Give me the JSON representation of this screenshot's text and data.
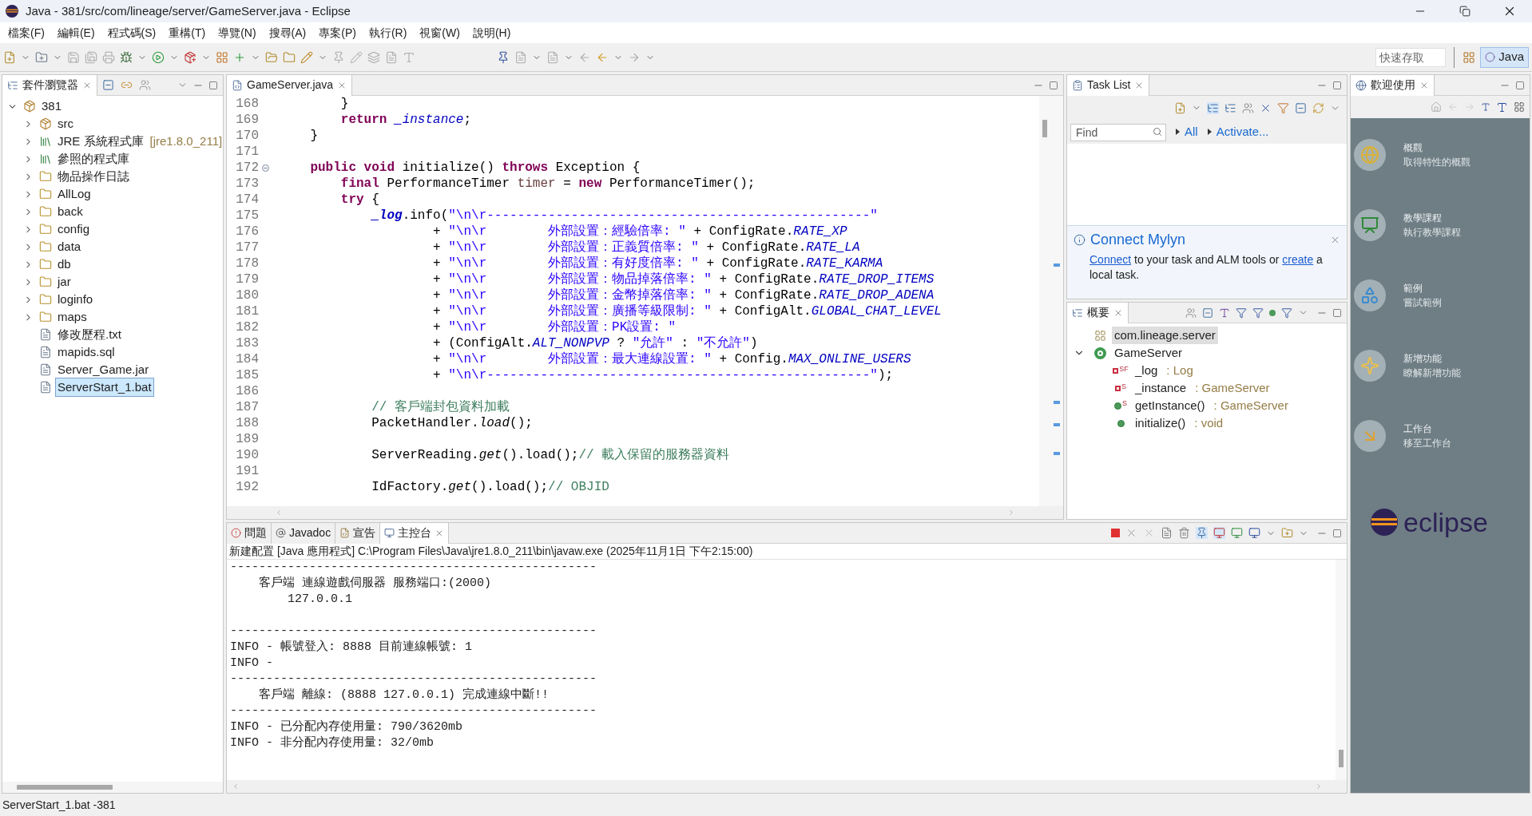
{
  "window": {
    "title": "Java - 381/src/com/lineage/server/GameServer.java - Eclipse"
  },
  "menu": [
    "檔案(F)",
    "編輯(E)",
    "程式碼(S)",
    "重構(T)",
    "導覽(N)",
    "搜尋(A)",
    "專案(P)",
    "執行(R)",
    "視窗(W)",
    "說明(H)"
  ],
  "quick_access": {
    "placeholder": "快速存取"
  },
  "perspective": {
    "label": "Java",
    "selected": true
  },
  "package_explorer": {
    "tab": "套件瀏覽器",
    "tree": [
      {
        "label": "381",
        "kind": "project",
        "expanded": true,
        "selected": false,
        "children": [
          {
            "label": "src",
            "kind": "source_folder",
            "expanded": false,
            "selected": false
          },
          {
            "label": "JRE 系統程式庫",
            "decoration": "[jre1.8.0_211]",
            "kind": "library",
            "expanded": false,
            "selected": false
          },
          {
            "label": "參照的程式庫",
            "kind": "library",
            "expanded": false,
            "selected": false
          },
          {
            "label": "物品操作日誌",
            "kind": "folder",
            "expanded": false,
            "selected": false
          },
          {
            "label": "AllLog",
            "kind": "folder",
            "expanded": false,
            "selected": false
          },
          {
            "label": "back",
            "kind": "folder",
            "expanded": false,
            "selected": false
          },
          {
            "label": "config",
            "kind": "folder",
            "expanded": false,
            "selected": false
          },
          {
            "label": "data",
            "kind": "folder",
            "expanded": false,
            "selected": false
          },
          {
            "label": "db",
            "kind": "folder",
            "expanded": false,
            "selected": false
          },
          {
            "label": "jar",
            "kind": "folder",
            "expanded": false,
            "selected": false
          },
          {
            "label": "loginfo",
            "kind": "folder",
            "expanded": false,
            "selected": false
          },
          {
            "label": "maps",
            "kind": "folder",
            "expanded": false,
            "selected": false
          },
          {
            "label": "修改歷程.txt",
            "kind": "file",
            "selected": false
          },
          {
            "label": "mapids.sql",
            "kind": "file",
            "selected": false
          },
          {
            "label": "Server_Game.jar",
            "kind": "file",
            "selected": false
          },
          {
            "label": "ServerStart_1.bat",
            "kind": "file",
            "selected": true
          }
        ]
      }
    ]
  },
  "editor": {
    "tab": "GameServer.java",
    "lines": [
      {
        "number": "168",
        "segments": [
          {
            "kind": "plain",
            "text": "        }"
          }
        ]
      },
      {
        "number": "169",
        "segments": [
          {
            "kind": "keyword",
            "text": "        return "
          },
          {
            "kind": "static_field",
            "text": "_instance"
          },
          {
            "kind": "plain",
            "text": ";"
          }
        ]
      },
      {
        "number": "170",
        "segments": [
          {
            "kind": "plain",
            "text": "    }"
          }
        ]
      },
      {
        "number": "171"
      },
      {
        "number": "172",
        "fold_toggle": true,
        "segments": [
          {
            "kind": "keyword",
            "text": "    public void"
          },
          {
            "kind": "plain",
            "text": " initialize() "
          },
          {
            "kind": "keyword",
            "text": "throws"
          },
          {
            "kind": "plain",
            "text": " Exception {"
          }
        ]
      },
      {
        "number": "173",
        "segments": [
          {
            "kind": "keyword",
            "text": "        final"
          },
          {
            "kind": "plain",
            "text": " PerformanceTimer "
          },
          {
            "kind": "local",
            "text": "timer"
          },
          {
            "kind": "plain",
            "text": " = "
          },
          {
            "kind": "keyword",
            "text": "new"
          },
          {
            "kind": "plain",
            "text": " PerformanceTimer();"
          }
        ]
      },
      {
        "number": "174",
        "segments": [
          {
            "kind": "keyword",
            "text": "        try"
          },
          {
            "kind": "plain",
            "text": " {"
          }
        ]
      },
      {
        "number": "175",
        "segments": [
          {
            "kind": "static_final_field",
            "text": "            _log"
          },
          {
            "kind": "plain",
            "text": ".info("
          },
          {
            "kind": "string",
            "text": "\"\\n\\r--------------------------------------------------\""
          }
        ]
      },
      {
        "number": "176",
        "segments": [
          {
            "kind": "plain",
            "text": "                    + "
          },
          {
            "kind": "string",
            "text": "\"\\n\\r        外部設置：經驗倍率: \""
          },
          {
            "kind": "plain",
            "text": " + ConfigRate."
          },
          {
            "kind": "static_field",
            "text": "RATE_XP"
          }
        ]
      },
      {
        "number": "177",
        "segments": [
          {
            "kind": "plain",
            "text": "                    + "
          },
          {
            "kind": "string",
            "text": "\"\\n\\r        外部設置：正義質倍率: \""
          },
          {
            "kind": "plain",
            "text": " + ConfigRate."
          },
          {
            "kind": "static_field",
            "text": "RATE_LA"
          }
        ]
      },
      {
        "number": "178",
        "segments": [
          {
            "kind": "plain",
            "text": "                    + "
          },
          {
            "kind": "string",
            "text": "\"\\n\\r        外部設置：有好度倍率: \""
          },
          {
            "kind": "plain",
            "text": " + ConfigRate."
          },
          {
            "kind": "static_field",
            "text": "RATE_KARMA"
          }
        ]
      },
      {
        "number": "179",
        "segments": [
          {
            "kind": "plain",
            "text": "                    + "
          },
          {
            "kind": "string",
            "text": "\"\\n\\r        外部設置：物品掉落倍率: \""
          },
          {
            "kind": "plain",
            "text": " + ConfigRate."
          },
          {
            "kind": "static_field",
            "text": "RATE_DROP_ITEMS"
          }
        ]
      },
      {
        "number": "180",
        "segments": [
          {
            "kind": "plain",
            "text": "                    + "
          },
          {
            "kind": "string",
            "text": "\"\\n\\r        外部設置：金幣掉落倍率: \""
          },
          {
            "kind": "plain",
            "text": " + ConfigRate."
          },
          {
            "kind": "static_field",
            "text": "RATE_DROP_ADENA"
          }
        ]
      },
      {
        "number": "181",
        "segments": [
          {
            "kind": "plain",
            "text": "                    + "
          },
          {
            "kind": "string",
            "text": "\"\\n\\r        外部設置：廣播等級限制: \""
          },
          {
            "kind": "plain",
            "text": " + ConfigAlt."
          },
          {
            "kind": "static_field",
            "text": "GLOBAL_CHAT_LEVEL"
          }
        ]
      },
      {
        "number": "182",
        "segments": [
          {
            "kind": "plain",
            "text": "                    + "
          },
          {
            "kind": "string",
            "text": "\"\\n\\r        外部設置：PK設置: \""
          }
        ]
      },
      {
        "number": "183",
        "segments": [
          {
            "kind": "plain",
            "text": "                    + (ConfigAlt."
          },
          {
            "kind": "static_field",
            "text": "ALT_NONPVP"
          },
          {
            "kind": "plain",
            "text": " ? "
          },
          {
            "kind": "string",
            "text": "\"允許\""
          },
          {
            "kind": "plain",
            "text": " : "
          },
          {
            "kind": "string",
            "text": "\"不允許\""
          },
          {
            "kind": "plain",
            "text": ")"
          }
        ]
      },
      {
        "number": "184",
        "segments": [
          {
            "kind": "plain",
            "text": "                    + "
          },
          {
            "kind": "string",
            "text": "\"\\n\\r        外部設置：最大連線設置: \""
          },
          {
            "kind": "plain",
            "text": " + Config."
          },
          {
            "kind": "static_field",
            "text": "MAX_ONLINE_USERS"
          }
        ]
      },
      {
        "number": "185",
        "segments": [
          {
            "kind": "plain",
            "text": "                    + "
          },
          {
            "kind": "string",
            "text": "\"\\n\\r--------------------------------------------------\""
          },
          {
            "kind": "plain",
            "text": ");"
          }
        ]
      },
      {
        "number": "186"
      },
      {
        "number": "187",
        "segments": [
          {
            "kind": "comment",
            "text": "            // 客戶端封包資料加載"
          }
        ]
      },
      {
        "number": "188",
        "segments": [
          {
            "kind": "plain",
            "text": "            PacketHandler."
          },
          {
            "kind": "static_call",
            "text": "load"
          },
          {
            "kind": "plain",
            "text": "();"
          }
        ]
      },
      {
        "number": "189"
      },
      {
        "number": "190",
        "segments": [
          {
            "kind": "plain",
            "text": "            ServerReading."
          },
          {
            "kind": "static_call",
            "text": "get"
          },
          {
            "kind": "plain",
            "text": "().load();"
          },
          {
            "kind": "comment",
            "text": "// 載入保留的服務器資料"
          }
        ]
      },
      {
        "number": "191"
      },
      {
        "number": "192",
        "segments": [
          {
            "kind": "plain",
            "text": "            IdFactory."
          },
          {
            "kind": "static_call",
            "text": "get"
          },
          {
            "kind": "plain",
            "text": "().load();"
          },
          {
            "kind": "comment",
            "text": "// OBJID"
          }
        ]
      }
    ]
  },
  "task_list": {
    "tab": "Task List",
    "find": {
      "placeholder": "Find"
    },
    "filters": [
      "All",
      "Activate..."
    ],
    "mylyn": {
      "title": "Connect Mylyn",
      "parts": [
        {
          "kind": "link",
          "text": "Connect"
        },
        {
          "kind": "text",
          "text": " to your task and ALM tools or "
        },
        {
          "kind": "link",
          "text": "create"
        },
        {
          "kind": "text",
          "text": " a local task."
        }
      ]
    }
  },
  "outline": {
    "tab": "概要",
    "items": [
      {
        "label": "com.lineage.server",
        "kind": "package",
        "selected": true
      },
      {
        "label": "GameServer",
        "kind": "class",
        "expanded": true,
        "selected": false,
        "children": [
          {
            "label": "_log",
            "type": ": Log",
            "kind": "field",
            "badge": "SF",
            "selected": false
          },
          {
            "label": "_instance",
            "type": ": GameServer",
            "kind": "field",
            "badge": "S",
            "selected": false
          },
          {
            "label": "getInstance()",
            "type": ": GameServer",
            "kind": "method",
            "badge": "S",
            "selected": false
          },
          {
            "label": "initialize()",
            "type": ": void",
            "kind": "method",
            "selected": false
          }
        ]
      }
    ]
  },
  "welcome": {
    "tab": "歡迎使用",
    "items": [
      {
        "kind": "globe",
        "title": "概觀",
        "subtitle": "取得特性的概觀"
      },
      {
        "kind": "tutorial",
        "title": "教學課程",
        "subtitle": "執行教學課程"
      },
      {
        "kind": "samples",
        "title": "範例",
        "subtitle": "嘗試範例"
      },
      {
        "kind": "whatsnew",
        "title": "新增功能",
        "subtitle": "瞭解新增功能"
      },
      {
        "kind": "workbench",
        "title": "工作台",
        "subtitle": "移至工作台"
      }
    ],
    "logo_text": "eclipse"
  },
  "console": {
    "tabs": [
      {
        "label": "問題",
        "kind": "problems",
        "selected": false
      },
      {
        "label": "Javadoc",
        "kind": "javadoc",
        "selected": false
      },
      {
        "label": "宣告",
        "kind": "declaration",
        "selected": false
      },
      {
        "label": "主控台",
        "kind": "console",
        "selected": true
      }
    ],
    "header": "新建配置 [Java 應用程式] C:\\Program Files\\Java\\jre1.8.0_211\\bin\\javaw.exe (2025年11月1日 下午2:15:00)",
    "blocks": [
      {
        "lines": [
          {
            "text": "---------------------------------------------------"
          },
          {
            "text": "    客戶端 連線遊戲伺服器 服務端口:(2000)"
          },
          {
            "text": "        127.0.0.1"
          }
        ]
      },
      {
        "lines": [
          {
            "text": "---------------------------------------------------"
          },
          {
            "text": "INFO - 帳號登入: 8888 目前連線帳號: 1"
          },
          {
            "text": "INFO -"
          },
          {
            "text": "---------------------------------------------------"
          },
          {
            "text": "    客戶端 離線: (8888 127.0.0.1) 完成連線中斷!!"
          },
          {
            "text": "---------------------------------------------------"
          },
          {
            "text": "INFO - 已分配內存使用量: 790/3620mb"
          },
          {
            "text": "INFO - 非分配內存使用量: 32/0mb"
          }
        ]
      }
    ]
  },
  "status_bar": "ServerStart_1.bat -381"
}
